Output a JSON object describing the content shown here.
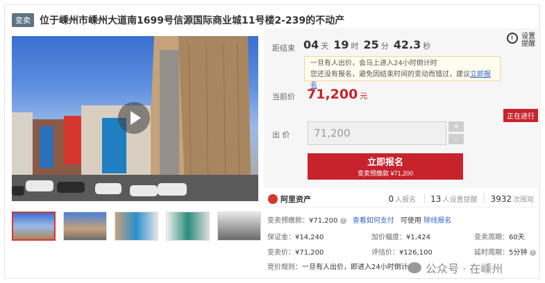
{
  "header": {
    "badge": "变卖",
    "title": "位于嵊州市嵊州大道南1699号信源国际商业城11号楼2-239的不动产"
  },
  "countdown": {
    "label": "距结束",
    "days": "04",
    "days_unit": "天",
    "hours": "19",
    "hours_unit": "时",
    "minutes": "25",
    "minutes_unit": "分",
    "seconds": "42.3",
    "seconds_unit": "秒"
  },
  "remind": {
    "label": "设置提醒",
    "icon": "alarm-clock-icon"
  },
  "notice": {
    "line1": "一旦有人出价，会马上进入24小时倒计时",
    "line2_prefix": "您还没有报名，避免因结束时间的变动而错过，建议",
    "line2_link": "立即报名"
  },
  "current_price": {
    "label": "当前价",
    "value": "71,200",
    "unit": "元"
  },
  "status": "正在进行",
  "bid": {
    "label": "出 价",
    "value": "71,200",
    "plus": "+",
    "minus": "-"
  },
  "signup": {
    "label": "立即报名",
    "sub": "变卖预缴款 ¥71,200"
  },
  "platform": {
    "name": "阿里资产",
    "icon": "ali-asset-logo-icon"
  },
  "stats": {
    "signups_count": "0",
    "signups_label": "人报名",
    "reminders_count": "13",
    "reminders_label": "人设置提醒",
    "views_count": "3932",
    "views_label": "次围观"
  },
  "details": {
    "deposit_key": "变卖预缴款：",
    "deposit_val": "¥71,200",
    "how_to_pay": "查看如何支付",
    "pay_method_prefix": "可使用",
    "pay_method_link": "除线报名",
    "guarantee_key": "保证金：",
    "guarantee_val": "¥14,240",
    "increment_key": "加价幅度：",
    "increment_val": "¥1,424",
    "period_key": "变卖周期：",
    "period_val": "60天",
    "sale_price_key": "变卖价：",
    "sale_price_val": "¥71,200",
    "appraisal_key": "评估价：",
    "appraisal_val": "¥126,100",
    "delay_key": "延时周期：",
    "delay_val": "5分钟",
    "rules_key": "竞价规则：",
    "rules_val": "一旦有人出价，即进入24小时倒计"
  },
  "watermark": {
    "text": "公众号 · 在嵊州",
    "icon": "wechat-icon"
  }
}
